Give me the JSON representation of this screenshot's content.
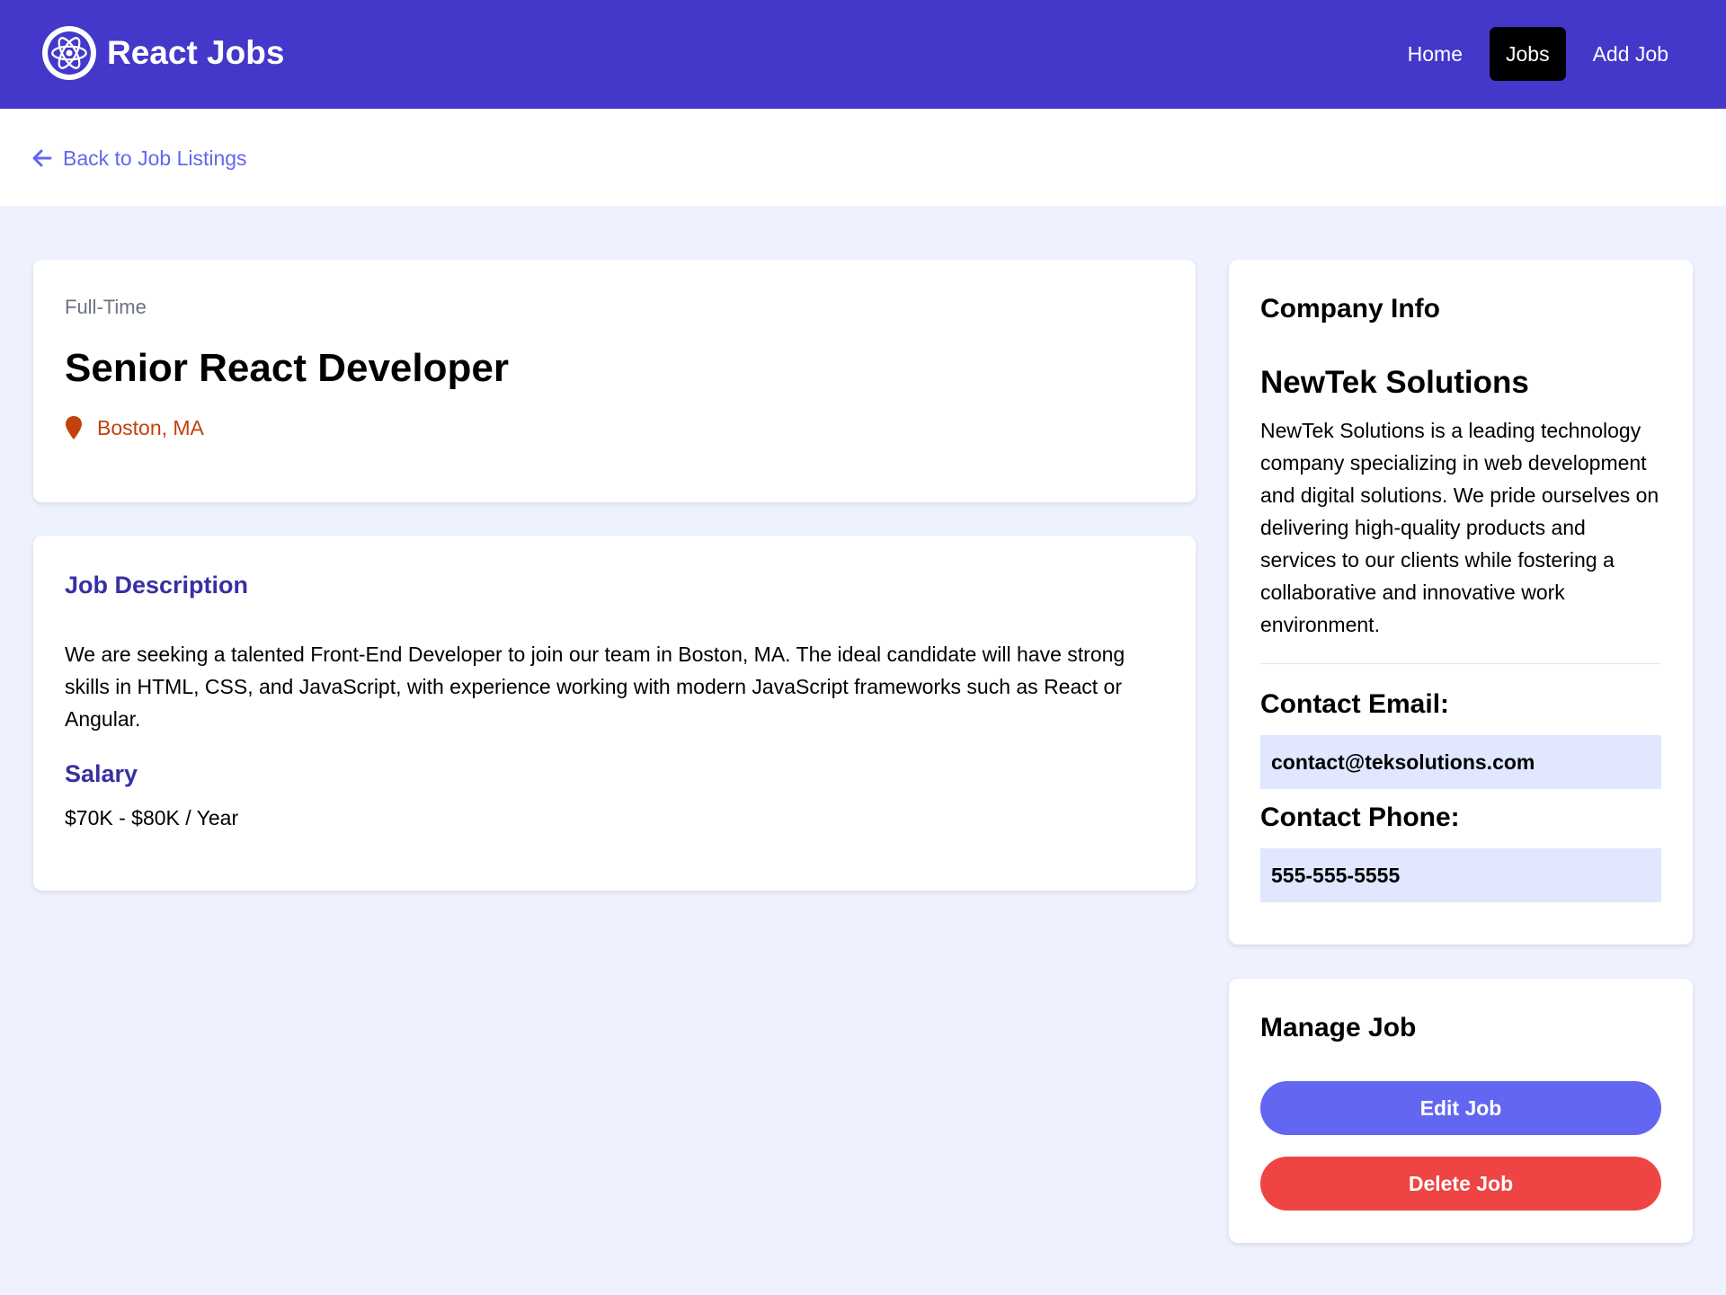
{
  "brand": {
    "name": "React Jobs",
    "logo_icon": "react-atom-icon"
  },
  "nav": {
    "links": [
      {
        "label": "Home"
      },
      {
        "label": "Jobs",
        "active": true
      },
      {
        "label": "Add Job"
      }
    ]
  },
  "back": {
    "label": "Back to Job Listings",
    "icon": "arrow-left-icon"
  },
  "job": {
    "type": "Full-Time",
    "title": "Senior React Developer",
    "location": "Boston, MA",
    "location_icon": "map-marker-icon",
    "description_heading": "Job Description",
    "description": "We are seeking a talented Front-End Developer to join our team in Boston, MA. The ideal candidate will have strong skills in HTML, CSS, and JavaScript, with experience working with modern JavaScript frameworks such as React or Angular.",
    "salary_heading": "Salary",
    "salary": "$70K - $80K / Year"
  },
  "company": {
    "heading": "Company Info",
    "name": "NewTek Solutions",
    "description": "NewTek Solutions is a leading technology company specializing in web development and digital solutions. We pride ourselves on delivering high-quality products and services to our clients while fostering a collaborative and innovative work environment.",
    "email_label": "Contact Email:",
    "email": "contact@teksolutions.com",
    "phone_label": "Contact Phone:",
    "phone": "555-555-5555"
  },
  "manage": {
    "heading": "Manage Job",
    "edit_label": "Edit Job",
    "delete_label": "Delete Job"
  },
  "colors": {
    "navbar": "#4338ca",
    "page_bg": "#eef2ff",
    "accent": "#6366f1",
    "heading_indigo": "#3730a3",
    "location": "#c2410c",
    "danger": "#ef4444",
    "contact_bg": "#e0e7ff"
  }
}
